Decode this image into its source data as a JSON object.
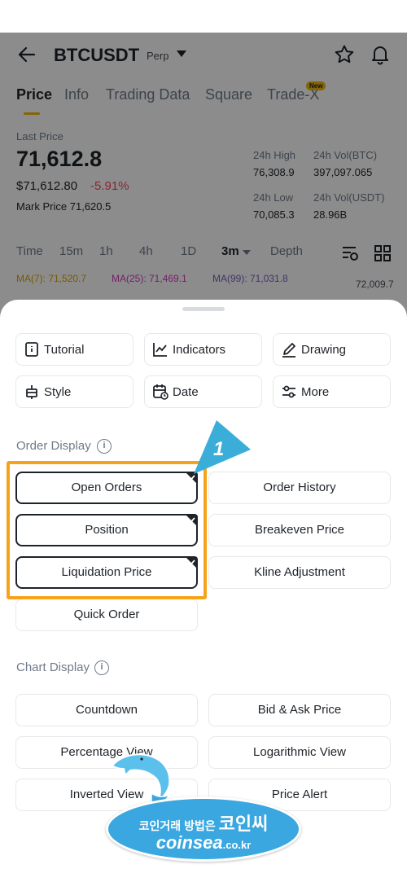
{
  "header": {
    "pair": "BTCUSDT",
    "contract": "Perp"
  },
  "tabs": [
    {
      "label": "Price"
    },
    {
      "label": "Info"
    },
    {
      "label": "Trading Data"
    },
    {
      "label": "Square"
    },
    {
      "label": "Trade-X"
    }
  ],
  "new_badge": "New",
  "price": {
    "last_label": "Last Price",
    "last": "71,612.8",
    "usd": "$71,612.80",
    "change": "-5.91%",
    "mark_label": "Mark Price",
    "mark": "71,620.5"
  },
  "stats": {
    "high_label": "24h High",
    "high": "76,308.9",
    "vol_btc_label": "24h Vol(BTC)",
    "vol_btc": "397,097.065",
    "low_label": "24h Low",
    "low": "70,085.3",
    "vol_usdt_label": "24h Vol(USDT)",
    "vol_usdt": "28.96B"
  },
  "timeframes": [
    {
      "label": "Time"
    },
    {
      "label": "15m"
    },
    {
      "label": "1h"
    },
    {
      "label": "4h"
    },
    {
      "label": "1D"
    },
    {
      "label": "3m"
    },
    {
      "label": "Depth"
    }
  ],
  "ma": [
    {
      "label": "MA(7): 71,520.7",
      "color": "#d9a400"
    },
    {
      "label": "MA(25): 71,469.1",
      "color": "#d63ac2"
    },
    {
      "label": "MA(99): 71,031.8",
      "color": "#7a5cc7"
    }
  ],
  "chart_price_tag": "72,009.7",
  "sheet": {
    "tools": [
      {
        "label": "Tutorial",
        "icon": "book-icon"
      },
      {
        "label": "Indicators",
        "icon": "indicator-chart-icon"
      },
      {
        "label": "Drawing",
        "icon": "pencil-icon"
      },
      {
        "label": "Style",
        "icon": "candlestick-icon"
      },
      {
        "label": "Date",
        "icon": "calendar-clock-icon"
      },
      {
        "label": "More",
        "icon": "sliders-icon"
      }
    ],
    "order_display_title": "Order Display",
    "order_options": [
      {
        "label": "Open Orders",
        "checked": true
      },
      {
        "label": "Order History",
        "checked": false
      },
      {
        "label": "Position",
        "checked": true
      },
      {
        "label": "Breakeven Price",
        "checked": false
      },
      {
        "label": "Liquidation Price",
        "checked": true
      },
      {
        "label": "Kline Adjustment",
        "checked": false
      },
      {
        "label": "Quick Order",
        "checked": false
      }
    ],
    "chart_display_title": "Chart Display",
    "chart_options": [
      {
        "label": "Countdown"
      },
      {
        "label": "Bid & Ask Price"
      },
      {
        "label": "Percentage View"
      },
      {
        "label": "Logarithmic View"
      },
      {
        "label": "Inverted View"
      },
      {
        "label": "Price Alert"
      }
    ]
  },
  "annotation": {
    "step": "1"
  },
  "watermark": {
    "line1_small": "코인거래 방법은",
    "line1_big": "코인씨",
    "line2": "coinsea",
    "line2_suffix": ".co.kr"
  },
  "colors": {
    "accent": "#f0b90b",
    "negative": "#f6465d",
    "highlight": "#f7a21b",
    "pointer": "#3aaed8"
  }
}
